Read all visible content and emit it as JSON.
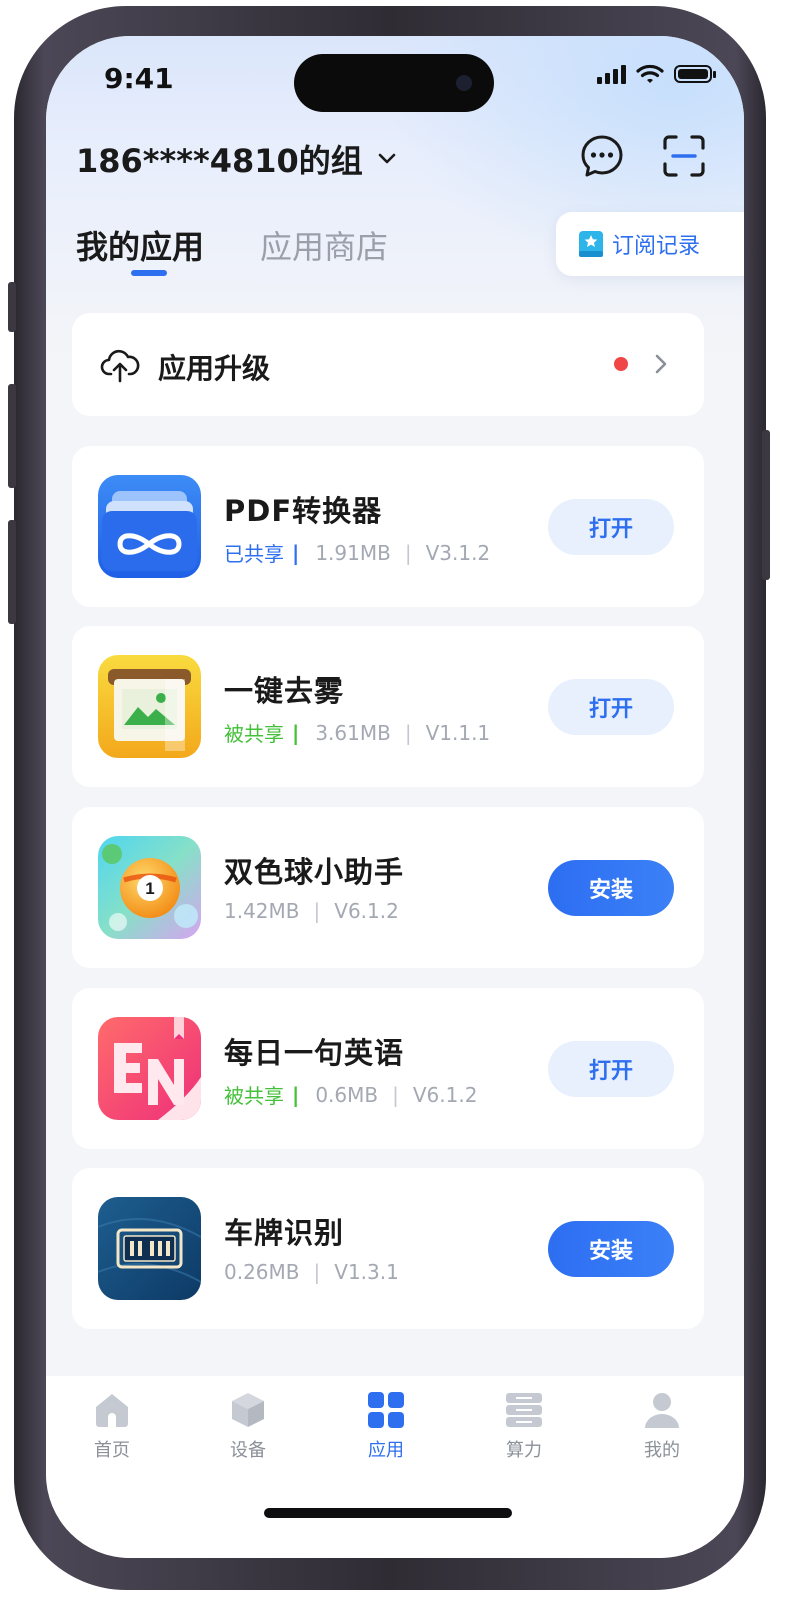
{
  "status_bar": {
    "time": "9:41"
  },
  "header": {
    "group_title": "186****4810的组",
    "icons": [
      "chevron-down-icon",
      "message-icon",
      "scan-icon"
    ]
  },
  "tabs": [
    {
      "label": "我的应用",
      "active": true
    },
    {
      "label": "应用商店",
      "active": false
    }
  ],
  "subscription_button": {
    "label": "订阅记录",
    "icon": "subscription-icon"
  },
  "upgrade": {
    "label": "应用升级",
    "icon": "cloud-upload-icon",
    "has_badge": true
  },
  "apps": [
    {
      "name": "PDF转换器",
      "share": "已共享",
      "share_color": "#2e6ff0",
      "size": "1.91MB",
      "version": "V3.1.2",
      "action": "打开",
      "icon": "pdf-converter-icon"
    },
    {
      "name": "一键去雾",
      "share": "被共享",
      "share_color": "#44c03a",
      "size": "3.61MB",
      "version": "V1.1.1",
      "action": "打开",
      "icon": "dehaze-icon"
    },
    {
      "name": "双色球小助手",
      "share": "",
      "size": "1.42MB",
      "version": "V6.1.2",
      "action": "安装",
      "icon": "lottery-ball-icon"
    },
    {
      "name": "每日一句英语",
      "share": "被共享",
      "share_color": "#44c03a",
      "size": "0.6MB",
      "version": "V6.1.2",
      "action": "打开",
      "icon": "english-en-icon"
    },
    {
      "name": "车牌识别",
      "share": "",
      "size": "0.26MB",
      "version": "V1.3.1",
      "action": "安装",
      "icon": "license-plate-icon"
    }
  ],
  "bottom_nav": [
    {
      "label": "首页",
      "icon": "home-icon",
      "active": false
    },
    {
      "label": "设备",
      "icon": "device-box-icon",
      "active": false
    },
    {
      "label": "应用",
      "icon": "apps-grid-icon",
      "active": true
    },
    {
      "label": "算力",
      "icon": "server-icon",
      "active": false
    },
    {
      "label": "我的",
      "icon": "profile-icon",
      "active": false
    }
  ],
  "colors": {
    "accent": "#2e6ff0",
    "shared_blue": "#2e6ff0",
    "shared_green": "#44c03a",
    "badge_red": "#f04646"
  }
}
